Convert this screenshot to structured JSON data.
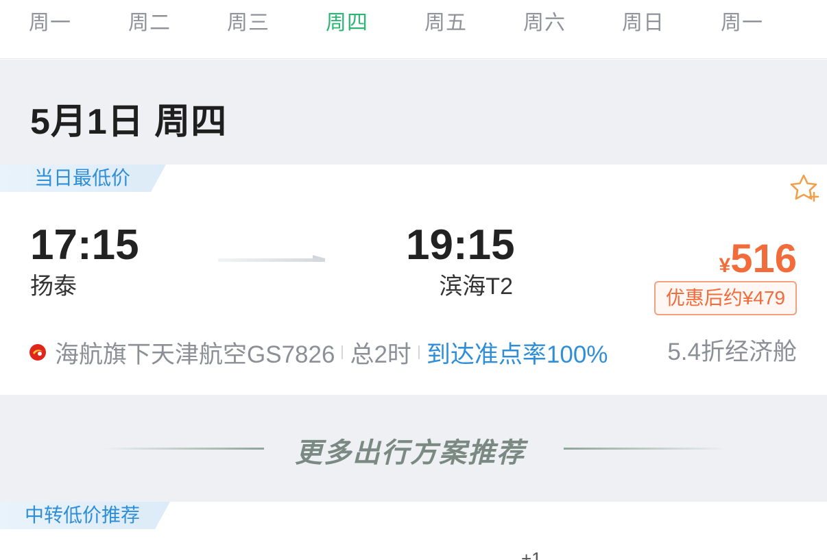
{
  "week": {
    "days": [
      "周一",
      "周二",
      "周三",
      "周四",
      "周五",
      "周六",
      "周日",
      "周一"
    ],
    "active_index": 3
  },
  "date_header": {
    "title": "5月1日 周四"
  },
  "flight": {
    "tag": "当日最低价",
    "departure_time": "17:15",
    "departure_airport": "扬泰",
    "arrival_time": "19:15",
    "arrival_airport": "滨海T2",
    "price_currency": "¥",
    "price_amount": "516",
    "discount_label": "优惠后约¥479",
    "airline_info": "海航旗下天津航空GS7826",
    "duration": "总2时",
    "ontime_rate": "到达准点率100%",
    "cabin": "5.4折经济舱",
    "favorite_icon": "star-plus-icon",
    "airline_logo_icon": "tianjin-airlines-logo"
  },
  "more": {
    "title": "更多出行方案推荐"
  },
  "transfer": {
    "tag": "中转低价推荐",
    "plus_day": "+1"
  },
  "colors": {
    "active_day": "#2bb673",
    "price": "#f26b3a",
    "link_blue": "#2f8ed8",
    "section_bg": "#eff0f4"
  }
}
